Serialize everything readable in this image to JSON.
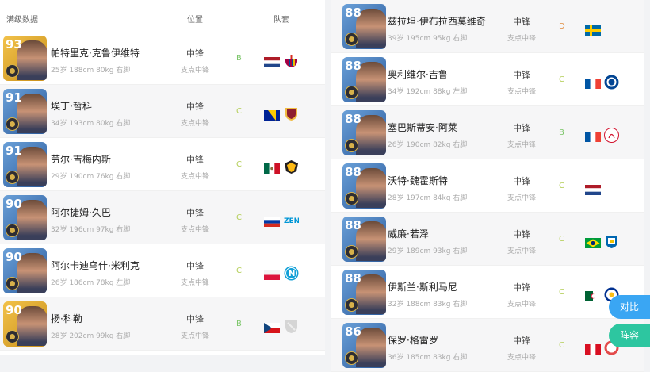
{
  "header": {
    "title": "满级数据",
    "position": "位置",
    "team": "队套"
  },
  "left": [
    {
      "rating": "93",
      "name": "帕特里克·克鲁伊维特",
      "info": "25岁 188cm 80kg 右脚",
      "pos": "中锋",
      "pos2": "支点中锋",
      "grade": "B",
      "gradeColor": "#7cc66a",
      "card": "gold",
      "flag": "nl",
      "club": "barca"
    },
    {
      "rating": "91",
      "name": "埃丁·哲科",
      "info": "34岁 193cm 80kg 右脚",
      "pos": "中锋",
      "pos2": "支点中锋",
      "grade": "C",
      "gradeColor": "#b5cf5a",
      "card": "blue",
      "flag": "ba",
      "club": "roma"
    },
    {
      "rating": "91",
      "name": "劳尔·吉梅内斯",
      "info": "29岁 190cm 76kg 右脚",
      "pos": "中锋",
      "pos2": "支点中锋",
      "grade": "C",
      "gradeColor": "#b5cf5a",
      "card": "blue",
      "flag": "mx",
      "club": "wolves"
    },
    {
      "rating": "90",
      "name": "阿尔捷姆·久巴",
      "info": "32岁 196cm 97kg 右脚",
      "pos": "中锋",
      "pos2": "支点中锋",
      "grade": "C",
      "gradeColor": "#b5cf5a",
      "card": "blue",
      "flag": "ru",
      "club": "zenit"
    },
    {
      "rating": "90",
      "name": "阿尔卡迪乌什·米利克",
      "info": "26岁 186cm 78kg 左脚",
      "pos": "中锋",
      "pos2": "支点中锋",
      "grade": "C",
      "gradeColor": "#b5cf5a",
      "card": "blue",
      "flag": "pl",
      "club": "napoli"
    },
    {
      "rating": "90",
      "name": "扬·科勒",
      "info": "28岁 202cm 99kg 右脚",
      "pos": "中锋",
      "pos2": "支点中锋",
      "grade": "B",
      "gradeColor": "#7cc66a",
      "card": "gold",
      "flag": "cz",
      "club": "shield"
    }
  ],
  "right": [
    {
      "rating": "88",
      "name": "兹拉坦·伊布拉西莫维奇",
      "info": "39岁 195cm 95kg 右脚",
      "pos": "中锋",
      "pos2": "支点中锋",
      "grade": "D",
      "gradeColor": "#e08a3a",
      "card": "blue",
      "flag": "se",
      "club": "none"
    },
    {
      "rating": "88",
      "name": "奥利维尔·吉鲁",
      "info": "34岁 192cm 88kg 左脚",
      "pos": "中锋",
      "pos2": "支点中锋",
      "grade": "C",
      "gradeColor": "#b5cf5a",
      "card": "blue",
      "flag": "fr",
      "club": "chelsea"
    },
    {
      "rating": "88",
      "name": "塞巴斯蒂安·阿莱",
      "info": "26岁 190cm 82kg 右脚",
      "pos": "中锋",
      "pos2": "支点中锋",
      "grade": "B",
      "gradeColor": "#7cc66a",
      "card": "blue",
      "flag": "fr",
      "club": "ajax"
    },
    {
      "rating": "88",
      "name": "沃特·魏霍斯特",
      "info": "28岁 197cm 84kg 右脚",
      "pos": "中锋",
      "pos2": "支点中锋",
      "grade": "C",
      "gradeColor": "#b5cf5a",
      "card": "blue",
      "flag": "nl",
      "club": "none"
    },
    {
      "rating": "88",
      "name": "威廉·若泽",
      "info": "29岁 189cm 93kg 右脚",
      "pos": "中锋",
      "pos2": "支点中锋",
      "grade": "C",
      "gradeColor": "#b5cf5a",
      "card": "blue",
      "flag": "br",
      "club": "sociedad"
    },
    {
      "rating": "88",
      "name": "伊斯兰·斯利马尼",
      "info": "32岁 188cm 83kg 右脚",
      "pos": "中锋",
      "pos2": "支点中锋",
      "grade": "C",
      "gradeColor": "#b5cf5a",
      "card": "blue",
      "flag": "dz",
      "club": "leicester"
    },
    {
      "rating": "86",
      "name": "保罗·格雷罗",
      "info": "36岁 185cm 83kg 右脚",
      "pos": "中锋",
      "pos2": "支点中锋",
      "grade": "C",
      "gradeColor": "#b5cf5a",
      "card": "blue",
      "flag": "pe",
      "club": "inter"
    }
  ],
  "buttons": {
    "compare": "对比",
    "lineup": "阵容"
  },
  "colors": {
    "compare": "#3aa6f3",
    "lineup": "#2dc6a0"
  }
}
